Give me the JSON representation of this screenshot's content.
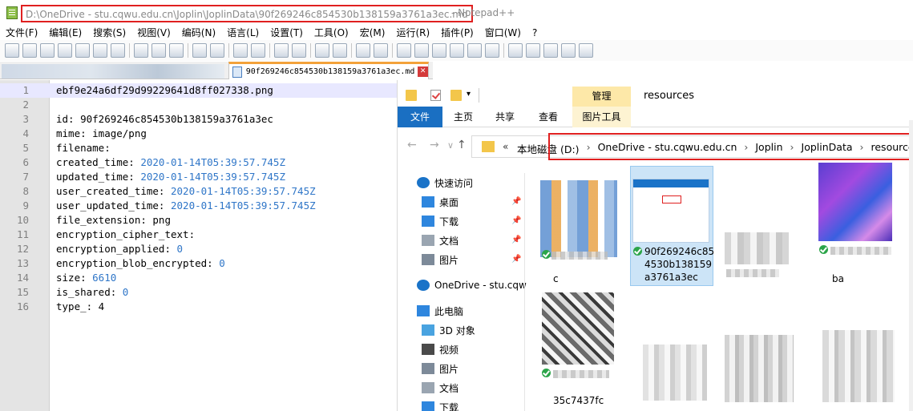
{
  "notepad": {
    "title_path": "D:\\OneDrive - stu.cqwu.edu.cn\\Joplin\\JoplinData\\90f269246c854530b138159a3761a3ec.md",
    "title_app": "- Notepad++",
    "menu": [
      "文件(F)",
      "编辑(E)",
      "搜索(S)",
      "视图(V)",
      "编码(N)",
      "语言(L)",
      "设置(T)",
      "工具(O)",
      "宏(M)",
      "运行(R)",
      "插件(P)",
      "窗口(W)",
      "?"
    ],
    "active_tab": "90f269246c854530b138159a3761a3ec.md",
    "lines": [
      {
        "n": "1",
        "key": "ebf9e24a6df29d99229641d8ff027338.png",
        "val": ""
      },
      {
        "n": "2",
        "key": "",
        "val": ""
      },
      {
        "n": "3",
        "key": "id: 90f269246c854530b138159a3761a3ec",
        "val": ""
      },
      {
        "n": "4",
        "key": "mime: image/png",
        "val": ""
      },
      {
        "n": "5",
        "key": "filename:",
        "val": ""
      },
      {
        "n": "6",
        "key": "created_time: ",
        "val": "2020-01-14T05:39:57.745Z"
      },
      {
        "n": "7",
        "key": "updated_time: ",
        "val": "2020-01-14T05:39:57.745Z"
      },
      {
        "n": "8",
        "key": "user_created_time: ",
        "val": "2020-01-14T05:39:57.745Z"
      },
      {
        "n": "9",
        "key": "user_updated_time: ",
        "val": "2020-01-14T05:39:57.745Z"
      },
      {
        "n": "10",
        "key": "file_extension: png",
        "val": ""
      },
      {
        "n": "11",
        "key": "encryption_cipher_text:",
        "val": ""
      },
      {
        "n": "12",
        "key": "encryption_applied: ",
        "val": "0"
      },
      {
        "n": "13",
        "key": "encryption_blob_encrypted: ",
        "val": "0"
      },
      {
        "n": "14",
        "key": "size: ",
        "val": "6610"
      },
      {
        "n": "15",
        "key": "is_shared: ",
        "val": "0"
      },
      {
        "n": "16",
        "key": "type_: 4",
        "val": ""
      }
    ]
  },
  "explorer": {
    "manage_tab": "管理",
    "window_title": "resources",
    "ribbon_tabs": [
      "文件",
      "主页",
      "共享",
      "查看",
      "图片工具"
    ],
    "breadcrumb_lead": "«",
    "breadcrumb": [
      "本地磁盘 (D:)",
      "OneDrive - stu.cqwu.edu.cn",
      "Joplin",
      "JoplinData",
      "resources"
    ],
    "nav": [
      {
        "label": "快速访问",
        "icon": "star-icon",
        "pinned": false
      },
      {
        "label": "桌面",
        "icon": "desktop-icon",
        "pinned": true
      },
      {
        "label": "下载",
        "icon": "download-icon",
        "pinned": true
      },
      {
        "label": "文档",
        "icon": "document-icon",
        "pinned": true
      },
      {
        "label": "图片",
        "icon": "pictures-icon",
        "pinned": true
      },
      {
        "label": "OneDrive - stu.cqw",
        "icon": "cloud-icon",
        "pinned": false
      },
      {
        "label": "此电脑",
        "icon": "computer-icon",
        "pinned": false
      },
      {
        "label": "3D 对象",
        "icon": "cube-icon",
        "pinned": false
      },
      {
        "label": "视频",
        "icon": "video-icon",
        "pinned": false
      },
      {
        "label": "图片",
        "icon": "pictures-icon",
        "pinned": false
      },
      {
        "label": "文档",
        "icon": "document-icon",
        "pinned": false
      },
      {
        "label": "下载",
        "icon": "download-icon",
        "pinned": false
      }
    ],
    "selected_file": "90f269246c85\n4530b138159\na3761a3ec",
    "partial_names": [
      "c",
      "ba",
      "35c7437fc"
    ],
    "colors": {
      "file_tab": "#1a6fc2",
      "manage": "#fde8a8",
      "highlight": "#e02020"
    }
  }
}
